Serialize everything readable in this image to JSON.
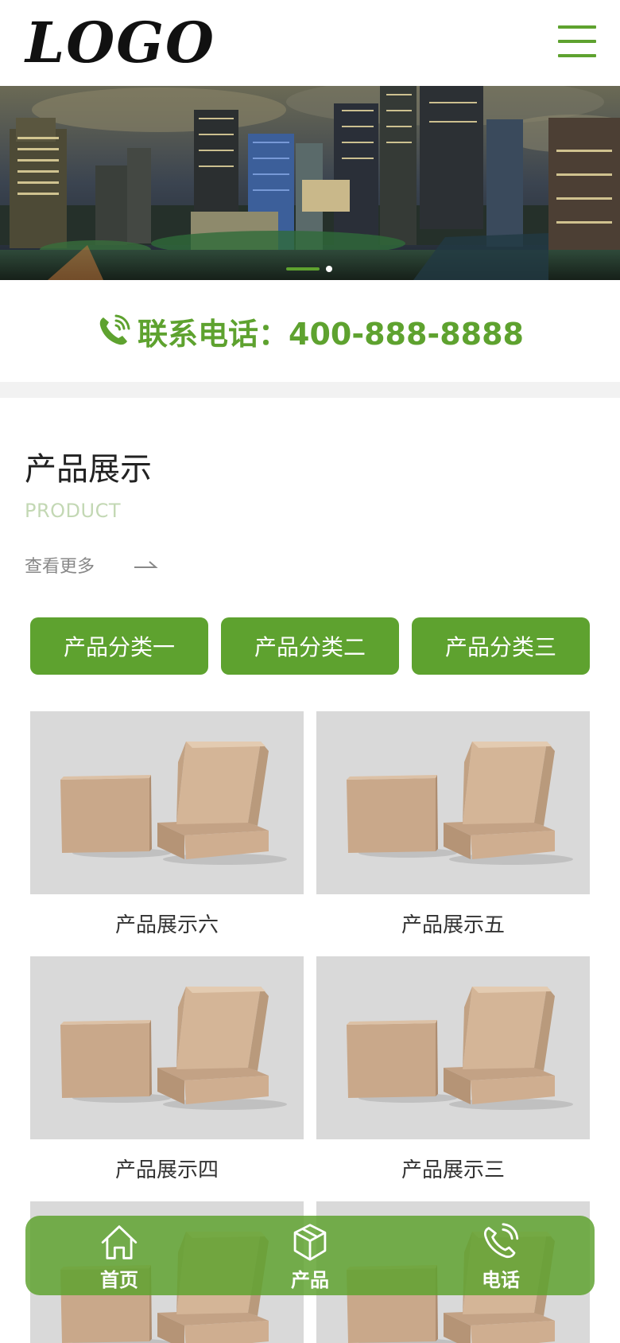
{
  "header": {
    "logo_text": "LOGO",
    "menu_icon": "hamburger-menu-icon"
  },
  "banner": {
    "description_icon": "city-night-skyline-image",
    "slides": 2,
    "active_slide": 1
  },
  "contact": {
    "label": "联系电话：400-888-8888",
    "icon": "phone-icon"
  },
  "products": {
    "title": "产品展示",
    "subtitle": "PRODUCT",
    "more_label": "查看更多",
    "categories": [
      "产品分类一",
      "产品分类二",
      "产品分类三"
    ],
    "items": [
      {
        "name": "产品展示六"
      },
      {
        "name": "产品展示五"
      },
      {
        "name": "产品展示四"
      },
      {
        "name": "产品展示三"
      },
      {
        "name": "",
        "image": "cardboard-box-image"
      },
      {
        "name": "",
        "image": "cardboard-box-image"
      }
    ]
  },
  "bottom_nav": {
    "items": [
      {
        "label": "首页",
        "icon": "home-icon"
      },
      {
        "label": "产品",
        "icon": "box-cube-icon"
      },
      {
        "label": "电话",
        "icon": "phone-icon"
      }
    ]
  },
  "colors": {
    "accent": "#5ea22f",
    "subtitle": "#c3d8b4",
    "band": "#f2f2f2",
    "product_bg": "#d9d9d9"
  }
}
